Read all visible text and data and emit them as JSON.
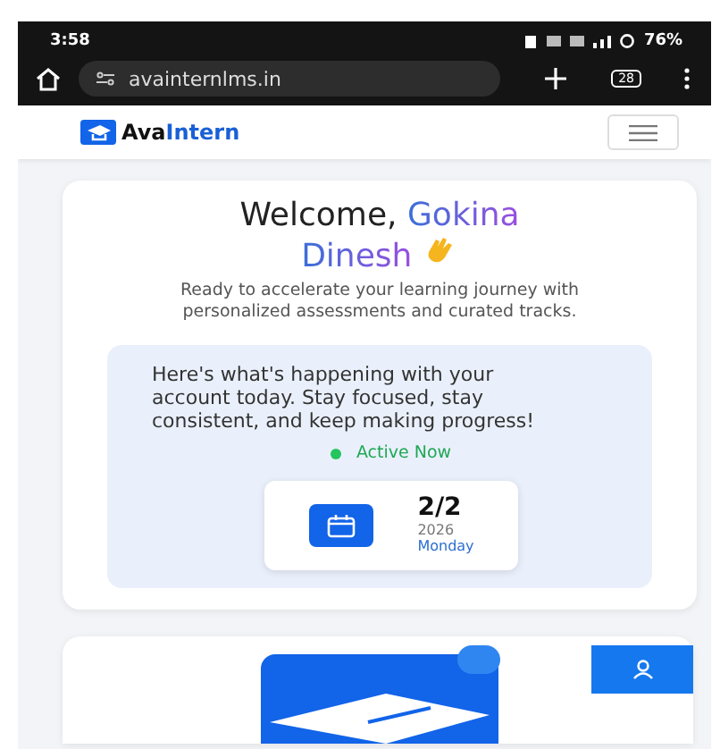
{
  "status_bar": {
    "time": "3:58",
    "battery": "76%"
  },
  "browser": {
    "url": "avainternlms.in",
    "tab_count": "28"
  },
  "site_header": {
    "logo_first": "Ava",
    "logo_second": "Intern"
  },
  "welcome": {
    "greeting": "Welcome,",
    "first_name": "Gokina",
    "last_name": "Dinesh",
    "subtitle": "Ready to accelerate your learning journey with personalized assessments and curated tracks.",
    "message": "Here's what's happening with your account today. Stay focused, stay consistent, and keep making progress!",
    "status": "Active Now",
    "date": {
      "day_month": "2/2",
      "year": "2026",
      "weekday": "Monday"
    }
  }
}
